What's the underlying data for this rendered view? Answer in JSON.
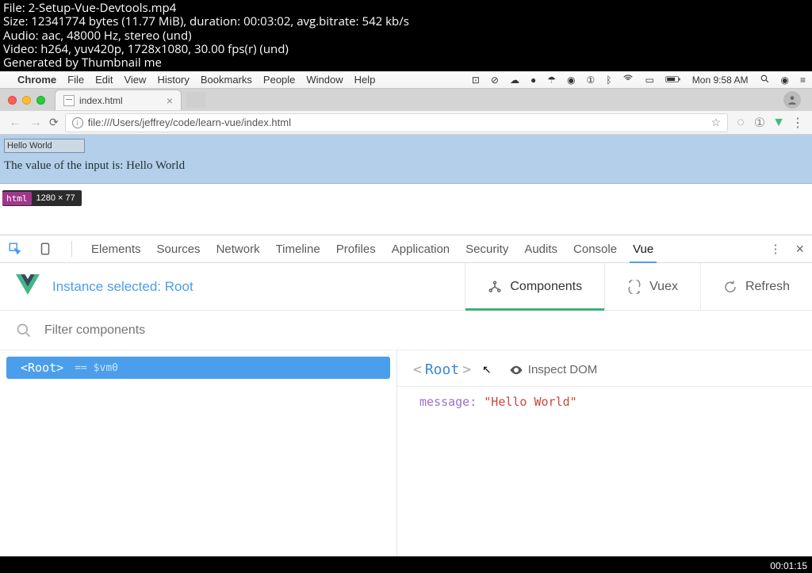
{
  "overlay": {
    "line1": "File: 2-Setup-Vue-Devtools.mp4",
    "line2": "Size: 12341774 bytes (11.77 MiB), duration: 00:03:02, avg.bitrate: 542 kb/s",
    "line3": "Audio: aac, 48000 Hz, stereo (und)",
    "line4": "Video: h264, yuv420p, 1728x1080, 30.00 fps(r) (und)",
    "line5": "Generated by Thumbnail me"
  },
  "menubar": {
    "app": "Chrome",
    "items": [
      "File",
      "Edit",
      "View",
      "History",
      "Bookmarks",
      "People",
      "Window",
      "Help"
    ],
    "clock": "Mon 9:58 AM"
  },
  "tab": {
    "title": "index.html"
  },
  "omnibox": {
    "url": "file:///Users/jeffrey/code/learn-vue/index.html"
  },
  "page": {
    "input_value": "Hello World",
    "sentence_prefix": "The value of the input is: ",
    "sentence_value": "Hello World"
  },
  "dim_badge": {
    "tag": "html",
    "dims": "1280 × 77"
  },
  "devtools": {
    "tabs": [
      "Elements",
      "Sources",
      "Network",
      "Timeline",
      "Profiles",
      "Application",
      "Security",
      "Audits",
      "Console",
      "Vue"
    ],
    "active_tab": "Vue"
  },
  "vue": {
    "status": "Instance selected: Root",
    "header_tabs": {
      "components": "Components",
      "vuex": "Vuex",
      "refresh": "Refresh"
    },
    "filter_placeholder": "Filter components",
    "tree": {
      "root_label": "<Root>",
      "vm_alias": "== $vm0"
    },
    "detail": {
      "title": "Root",
      "inspect_label": "Inspect DOM",
      "state_key": "message:",
      "state_value": "\"Hello World\""
    }
  },
  "timestamp": "00:01:15"
}
